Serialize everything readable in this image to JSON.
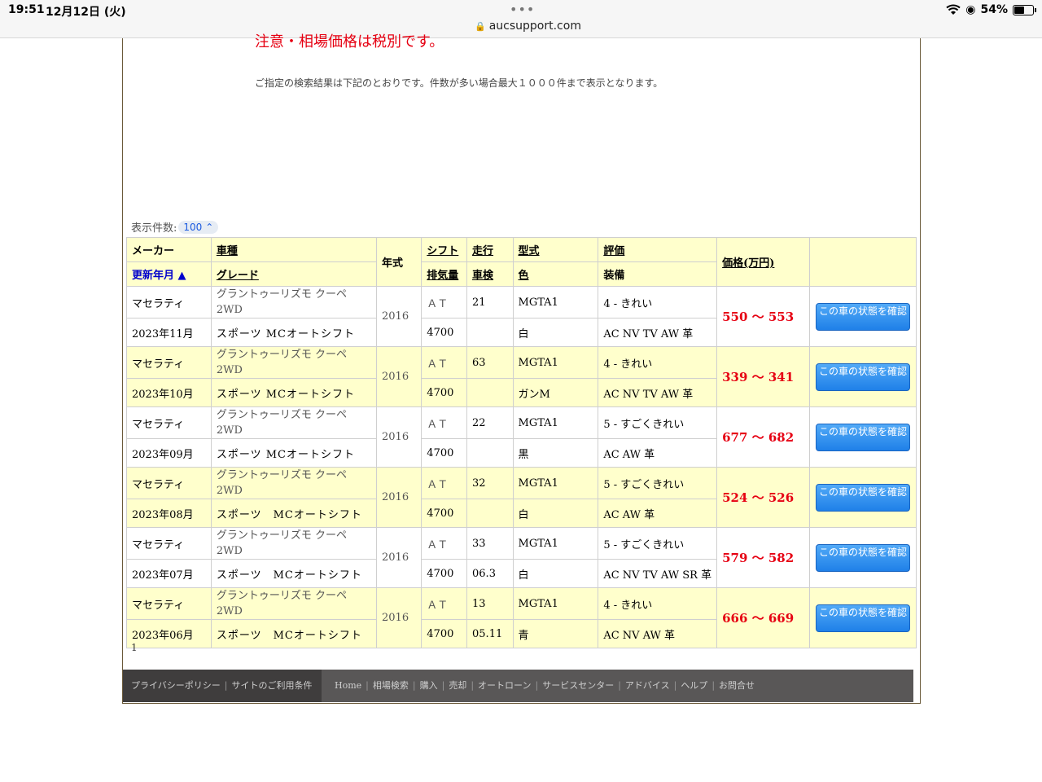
{
  "status": {
    "time": "19:51",
    "date": "12月12日 (火)",
    "url": "aucsupport.com",
    "battery": "54%"
  },
  "notice": "注意・相場価格は税別です。",
  "description": "ご指定の検索結果は下記のとおりです。件数が多い場合最大１０００件まで表示となります。",
  "per_page": {
    "label": "表示件数:",
    "value": "100"
  },
  "headers": {
    "maker": "メーカー",
    "updated": "更新年月 ▲",
    "model": "車種",
    "grade": "グレード",
    "year": "年式",
    "shift": "シフト",
    "displacement": "排気量",
    "mileage": "走行",
    "inspection": "車検",
    "type": "型式",
    "color": "色",
    "rating": "評価",
    "equipment": "装備",
    "price": "価格(万円)"
  },
  "rows": [
    {
      "maker": "マセラティ",
      "updated": "2023年11月",
      "model": "グラントゥーリズモ クーペ 2WD",
      "grade": "スポーツ MCオートシフト",
      "year": "2016",
      "shift": "ＡＴ",
      "displacement": "4700",
      "mileage": "21",
      "inspection": "",
      "type": "MGTA1",
      "color": "白",
      "rating": "4 - きれい",
      "equipment": "AC NV TV AW 革",
      "price": "550 〜 553",
      "button": "この車の状態を確認"
    },
    {
      "maker": "マセラティ",
      "updated": "2023年10月",
      "model": "グラントゥーリズモ クーペ 2WD",
      "grade": "スポーツ MCオートシフト",
      "year": "2016",
      "shift": "ＡＴ",
      "displacement": "4700",
      "mileage": "63",
      "inspection": "",
      "type": "MGTA1",
      "color": "ガンM",
      "rating": "4 - きれい",
      "equipment": "AC NV TV AW 革",
      "price": "339 〜 341",
      "button": "この車の状態を確認"
    },
    {
      "maker": "マセラティ",
      "updated": "2023年09月",
      "model": "グラントゥーリズモ クーペ 2WD",
      "grade": "スポーツ MCオートシフト",
      "year": "2016",
      "shift": "ＡＴ",
      "displacement": "4700",
      "mileage": "22",
      "inspection": "",
      "type": "MGTA1",
      "color": "黒",
      "rating": "5 - すごくきれい",
      "equipment": "AC AW 革",
      "price": "677 〜 682",
      "button": "この車の状態を確認"
    },
    {
      "maker": "マセラティ",
      "updated": "2023年08月",
      "model": "グラントゥーリズモ クーペ 2WD",
      "grade": "スポーツ　MCオートシフト",
      "year": "2016",
      "shift": "ＡＴ",
      "displacement": "4700",
      "mileage": "32",
      "inspection": "",
      "type": "MGTA1",
      "color": "白",
      "rating": "5 - すごくきれい",
      "equipment": "AC AW 革",
      "price": "524 〜 526",
      "button": "この車の状態を確認"
    },
    {
      "maker": "マセラティ",
      "updated": "2023年07月",
      "model": "グラントゥーリズモ クーペ 2WD",
      "grade": "スポーツ　MCオートシフト",
      "year": "2016",
      "shift": "ＡＴ",
      "displacement": "4700",
      "mileage": "33",
      "inspection": "06.3",
      "type": "MGTA1",
      "color": "白",
      "rating": "5 - すごくきれい",
      "equipment": "AC NV TV AW SR 革",
      "price": "579 〜 582",
      "button": "この車の状態を確認"
    },
    {
      "maker": "マセラティ",
      "updated": "2023年06月",
      "model": "グラントゥーリズモ クーペ 2WD",
      "grade": "スポーツ　MCオートシフト",
      "year": "2016",
      "shift": "ＡＴ",
      "displacement": "4700",
      "mileage": "13",
      "inspection": "05.11",
      "type": "MGTA1",
      "color": "青",
      "rating": "4 - きれい",
      "equipment": "AC NV AW 革",
      "price": "666 〜 669",
      "button": "この車の状態を確認"
    }
  ],
  "pager": "1",
  "footer": {
    "privacy": "プライバシーポリシー",
    "terms": "サイトのご利用条件",
    "nav": [
      "Home",
      "相場検索",
      "購入",
      "売却",
      "オートローン",
      "サービスセンター",
      "アドバイス",
      "ヘルプ",
      "お問合せ"
    ]
  }
}
